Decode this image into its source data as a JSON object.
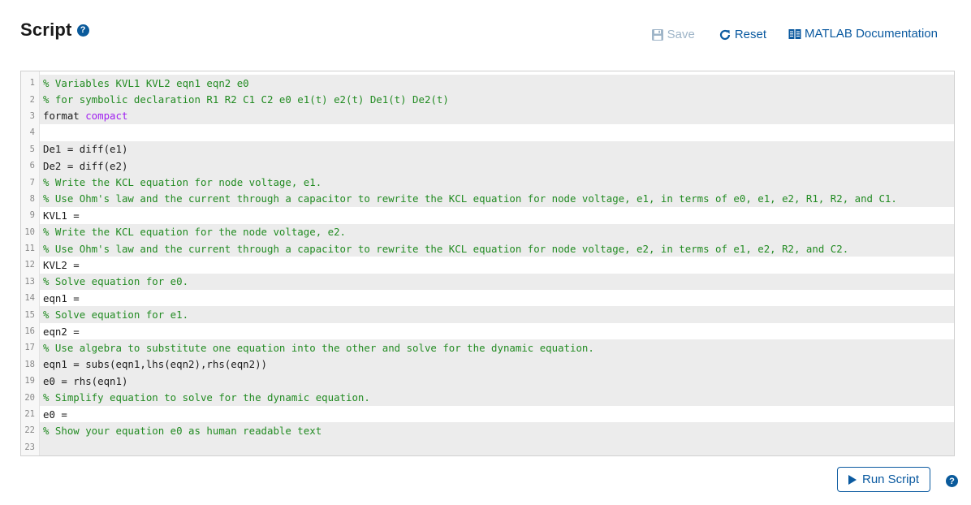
{
  "header": {
    "title": "Script",
    "help_glyph": "?"
  },
  "toolbar": {
    "save_label": "Save",
    "reset_label": "Reset",
    "docs_label": "MATLAB Documentation"
  },
  "editor": {
    "lines": [
      {
        "n": "1",
        "shade": true,
        "parts": [
          {
            "t": "% Variables KVL1 KVL2 eqn1 eqn2 e0",
            "c": "cmt"
          }
        ]
      },
      {
        "n": "2",
        "shade": true,
        "parts": [
          {
            "t": "% for symbolic declaration R1 R2 C1 C2 e0 e1(t) e2(t) De1(t) De2(t)",
            "c": "cmt"
          }
        ]
      },
      {
        "n": "3",
        "shade": true,
        "parts": [
          {
            "t": "format ",
            "c": "plain"
          },
          {
            "t": "compact",
            "c": "kw-str"
          }
        ]
      },
      {
        "n": "4",
        "shade": false,
        "parts": []
      },
      {
        "n": "5",
        "shade": true,
        "parts": [
          {
            "t": "De1 = diff(e1)",
            "c": "plain"
          }
        ]
      },
      {
        "n": "6",
        "shade": true,
        "parts": [
          {
            "t": "De2 = diff(e2)",
            "c": "plain"
          }
        ]
      },
      {
        "n": "7",
        "shade": true,
        "parts": [
          {
            "t": "% Write the KCL equation for node voltage, e1.",
            "c": "cmt"
          }
        ]
      },
      {
        "n": "8",
        "shade": true,
        "parts": [
          {
            "t": "% Use Ohm's law and the current through a capacitor to rewrite the KCL equation for node voltage, e1, in terms of e0, e1, e2, R1, R2, and C1.",
            "c": "cmt"
          }
        ]
      },
      {
        "n": "9",
        "shade": false,
        "parts": [
          {
            "t": "KVL1 = ",
            "c": "plain"
          }
        ]
      },
      {
        "n": "10",
        "shade": true,
        "parts": [
          {
            "t": "% Write the KCL equation for the node voltage, e2.",
            "c": "cmt"
          }
        ]
      },
      {
        "n": "11",
        "shade": true,
        "parts": [
          {
            "t": "% Use Ohm's law and the current through a capacitor to rewrite the KCL equation for node voltage, e2, in terms of e1, e2, R2, and C2.",
            "c": "cmt"
          }
        ]
      },
      {
        "n": "12",
        "shade": false,
        "parts": [
          {
            "t": "KVL2 = ",
            "c": "plain"
          }
        ]
      },
      {
        "n": "13",
        "shade": true,
        "parts": [
          {
            "t": "% Solve equation for e0.",
            "c": "cmt"
          }
        ]
      },
      {
        "n": "14",
        "shade": false,
        "parts": [
          {
            "t": "eqn1 = ",
            "c": "plain"
          }
        ]
      },
      {
        "n": "15",
        "shade": true,
        "parts": [
          {
            "t": "% Solve equation for e1.",
            "c": "cmt"
          }
        ]
      },
      {
        "n": "16",
        "shade": false,
        "parts": [
          {
            "t": "eqn2 = ",
            "c": "plain"
          }
        ]
      },
      {
        "n": "17",
        "shade": true,
        "parts": [
          {
            "t": "% Use algebra to substitute one equation into the other and solve for the dynamic equation.",
            "c": "cmt"
          }
        ]
      },
      {
        "n": "18",
        "shade": true,
        "parts": [
          {
            "t": "eqn1 = subs(eqn1,lhs(eqn2),rhs(eqn2))",
            "c": "plain"
          }
        ]
      },
      {
        "n": "19",
        "shade": true,
        "parts": [
          {
            "t": "e0 = rhs(eqn1)",
            "c": "plain"
          }
        ]
      },
      {
        "n": "20",
        "shade": true,
        "parts": [
          {
            "t": "% Simplify equation to solve for the dynamic equation.",
            "c": "cmt"
          }
        ]
      },
      {
        "n": "21",
        "shade": false,
        "parts": [
          {
            "t": "e0 = ",
            "c": "plain"
          }
        ]
      },
      {
        "n": "22",
        "shade": true,
        "parts": [
          {
            "t": "% Show your equation e0 as human readable text",
            "c": "cmt"
          }
        ]
      },
      {
        "n": "23",
        "shade": true,
        "parts": []
      }
    ]
  },
  "footer": {
    "run_label": "Run Script",
    "help_glyph": "?"
  },
  "colors": {
    "accent": "#0b5aa0",
    "comment": "#228b22",
    "string": "#a020f0",
    "shade": "#ececec",
    "disabled": "#9fb5c8"
  },
  "icons": {
    "save": "floppy-disk-icon",
    "reset": "refresh-icon",
    "docs": "book-icon",
    "run": "play-icon",
    "help": "question-circle-icon"
  }
}
